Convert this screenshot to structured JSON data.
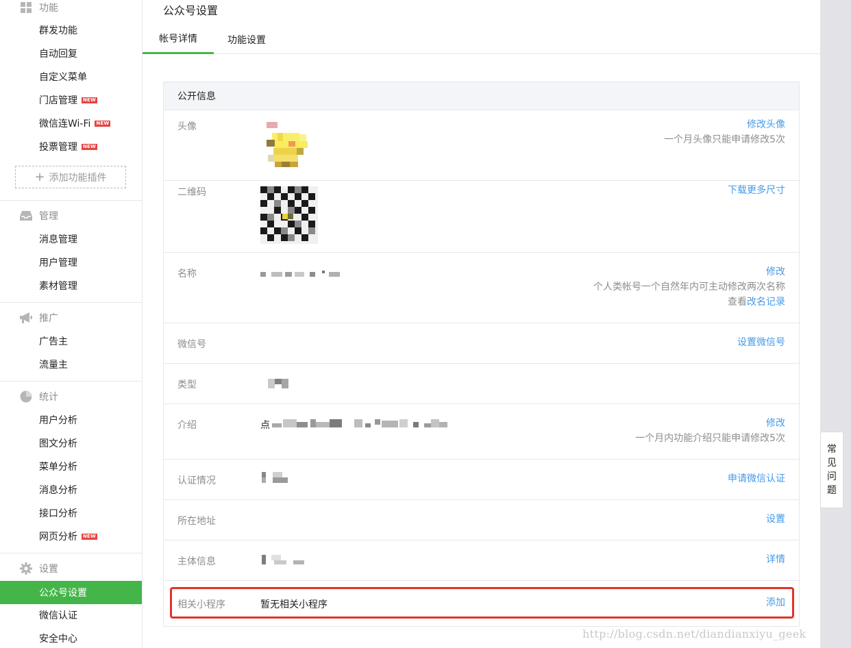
{
  "sidebar": {
    "sections": [
      {
        "title": "功能",
        "icon": "grid-icon",
        "items": [
          {
            "label": "群发功能",
            "badge": ""
          },
          {
            "label": "自动回复",
            "badge": ""
          },
          {
            "label": "自定义菜单",
            "badge": ""
          },
          {
            "label": "门店管理",
            "badge": "NEW"
          },
          {
            "label": "微信连Wi-Fi",
            "badge": "NEW"
          },
          {
            "label": "投票管理",
            "badge": "NEW"
          }
        ]
      },
      {
        "title": "管理",
        "icon": "inbox-icon",
        "items": [
          {
            "label": "消息管理"
          },
          {
            "label": "用户管理"
          },
          {
            "label": "素材管理"
          }
        ]
      },
      {
        "title": "推广",
        "icon": "megaphone-icon",
        "items": [
          {
            "label": "广告主"
          },
          {
            "label": "流量主"
          }
        ]
      },
      {
        "title": "统计",
        "icon": "pie-chart-icon",
        "items": [
          {
            "label": "用户分析"
          },
          {
            "label": "图文分析"
          },
          {
            "label": "菜单分析"
          },
          {
            "label": "消息分析"
          },
          {
            "label": "接口分析"
          },
          {
            "label": "网页分析",
            "badge": "NEW"
          }
        ]
      },
      {
        "title": "设置",
        "icon": "gear-icon",
        "items": [
          {
            "label": "公众号设置"
          },
          {
            "label": "微信认证"
          },
          {
            "label": "安全中心"
          }
        ]
      }
    ],
    "add_plugin": "添加功能插件",
    "active_item": "公众号设置"
  },
  "page": {
    "title": "公众号设置",
    "tabs": [
      "帐号详情",
      "功能设置"
    ],
    "active_tab": "帐号详情"
  },
  "panel": {
    "header": "公开信息",
    "rows": {
      "avatar": {
        "label": "头像",
        "action": "修改头像",
        "note": "一个月头像只能申请修改5次"
      },
      "qrcode": {
        "label": "二维码",
        "action": "下载更多尺寸"
      },
      "name": {
        "label": "名称",
        "action": "修改",
        "note": "个人类帐号一个自然年内可主动修改两次名称",
        "history_prefix": "查看",
        "history_link": "改名记录"
      },
      "wechat_id": {
        "label": "微信号",
        "action": "设置微信号"
      },
      "type": {
        "label": "类型"
      },
      "intro": {
        "label": "介绍",
        "value_prefix": "点",
        "action": "修改",
        "note": "一个月内功能介绍只能申请修改5次"
      },
      "verify": {
        "label": "认证情况",
        "action": "申请微信认证"
      },
      "location": {
        "label": "所在地址",
        "action": "设置"
      },
      "entity": {
        "label": "主体信息",
        "action": "详情"
      },
      "miniprogram": {
        "label": "相关小程序",
        "value": "暂无相关小程序",
        "action": "添加"
      }
    }
  },
  "faq": {
    "chars": [
      "常",
      "见",
      "问",
      "题"
    ]
  },
  "watermark": "http://blog.csdn.net/diandianxiyu_geek",
  "colors": {
    "accent_green": "#44b549",
    "link_blue": "#459ae9",
    "highlight_red": "#e4312b",
    "badge_red": "#e64340"
  }
}
